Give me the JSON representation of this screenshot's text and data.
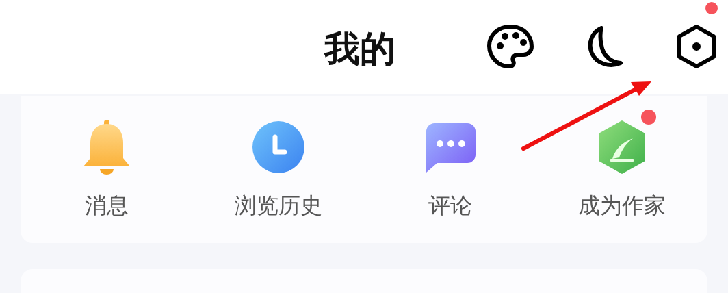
{
  "header": {
    "title": "我的",
    "actions": [
      {
        "kind": "palette",
        "badge": false
      },
      {
        "kind": "moon",
        "badge": false
      },
      {
        "kind": "settings",
        "badge": true
      }
    ]
  },
  "shortcuts": [
    {
      "kind": "bell",
      "label": "消息",
      "badge": false
    },
    {
      "kind": "clock",
      "label": "浏览历史",
      "badge": false
    },
    {
      "kind": "chat",
      "label": "评论",
      "badge": false
    },
    {
      "kind": "quill",
      "label": "成为作家",
      "badge": true
    }
  ]
}
